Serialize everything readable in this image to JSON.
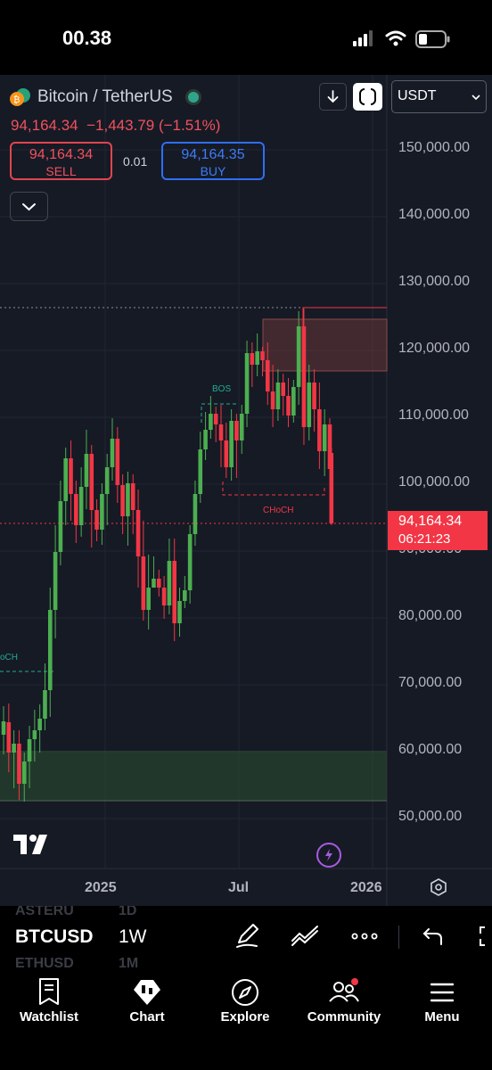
{
  "status_bar": {
    "time": "00.38"
  },
  "chart": {
    "symbol": "Bitcoin / TetherUS",
    "price": "94,164.34",
    "change": "−1,443.79",
    "change_pct": "(−1.51%)",
    "sell_price": "94,164.34",
    "sell_label": "SELL",
    "buy_price": "94,164.35",
    "buy_label": "BUY",
    "spread": "0.01",
    "currency": "USDT",
    "y_ticks": [
      "150,000.00",
      "140,000.00",
      "130,000.00",
      "120,000.00",
      "110,000.00",
      "100,000.00",
      "90,000.00",
      "80,000.00",
      "70,000.00",
      "60,000.00",
      "50,000.00"
    ],
    "last_price_tag": "94,164.34",
    "countdown": "06:21:23",
    "x_ticks": [
      "2025",
      "Jul",
      "2026"
    ],
    "annotations": {
      "bos": "BOS",
      "choch": "CHoCH",
      "choch_left": "oCH"
    },
    "colors": {
      "up": "#4caf50",
      "down": "#f23645",
      "background": "#161a25",
      "accent": "#2962ff"
    }
  },
  "toolbar": {
    "symbol": "BTCUSD",
    "interval": "1W",
    "ghost_symbol_top": "ASTERU",
    "ghost_interval_top": "1D",
    "ghost_symbol_bottom": "ETHUSD",
    "ghost_interval_bottom": "1M",
    "icons": [
      "pen-icon",
      "indicators-icon",
      "more-icon",
      "undo-icon",
      "fullscreen-icon"
    ]
  },
  "nav": {
    "items": [
      {
        "label": "Watchlist",
        "icon": "watchlist-icon"
      },
      {
        "label": "Chart",
        "icon": "chart-icon"
      },
      {
        "label": "Explore",
        "icon": "compass-icon"
      },
      {
        "label": "Community",
        "icon": "community-icon"
      },
      {
        "label": "Menu",
        "icon": "menu-icon"
      }
    ]
  }
}
